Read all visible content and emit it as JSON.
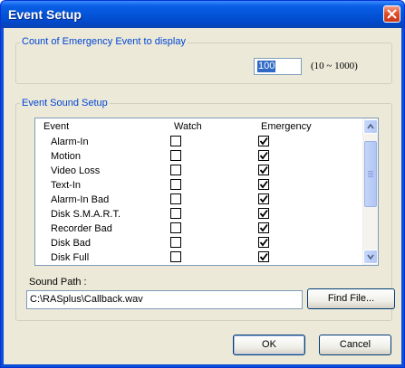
{
  "window": {
    "title": "Event Setup"
  },
  "count_group": {
    "legend": "Count of Emergency Event to display",
    "value": "100",
    "range": "(10 ~ 1000)"
  },
  "sound_group": {
    "legend": "Event Sound Setup",
    "columns": {
      "event": "Event",
      "watch": "Watch",
      "emergency": "Emergency"
    },
    "rows": [
      {
        "event": "Alarm-In",
        "watch": false,
        "emergency": true
      },
      {
        "event": "Motion",
        "watch": false,
        "emergency": true
      },
      {
        "event": "Video Loss",
        "watch": false,
        "emergency": true
      },
      {
        "event": "Text-In",
        "watch": false,
        "emergency": true
      },
      {
        "event": "Alarm-In Bad",
        "watch": false,
        "emergency": true
      },
      {
        "event": "Disk S.M.A.R.T.",
        "watch": false,
        "emergency": true
      },
      {
        "event": "Recorder Bad",
        "watch": false,
        "emergency": true
      },
      {
        "event": "Disk Bad",
        "watch": false,
        "emergency": true
      },
      {
        "event": "Disk Full",
        "watch": false,
        "emergency": true
      }
    ]
  },
  "sound_path": {
    "label": "Sound Path :",
    "value": "C:\\RASplus\\Callback.wav",
    "find_button": "Find File..."
  },
  "buttons": {
    "ok": "OK",
    "cancel": "Cancel"
  },
  "icons": {
    "close": "close-x-icon",
    "scroll_up": "scroll-up-arrow-icon",
    "scroll_down": "scroll-down-arrow-icon",
    "check": "checkmark-icon"
  }
}
